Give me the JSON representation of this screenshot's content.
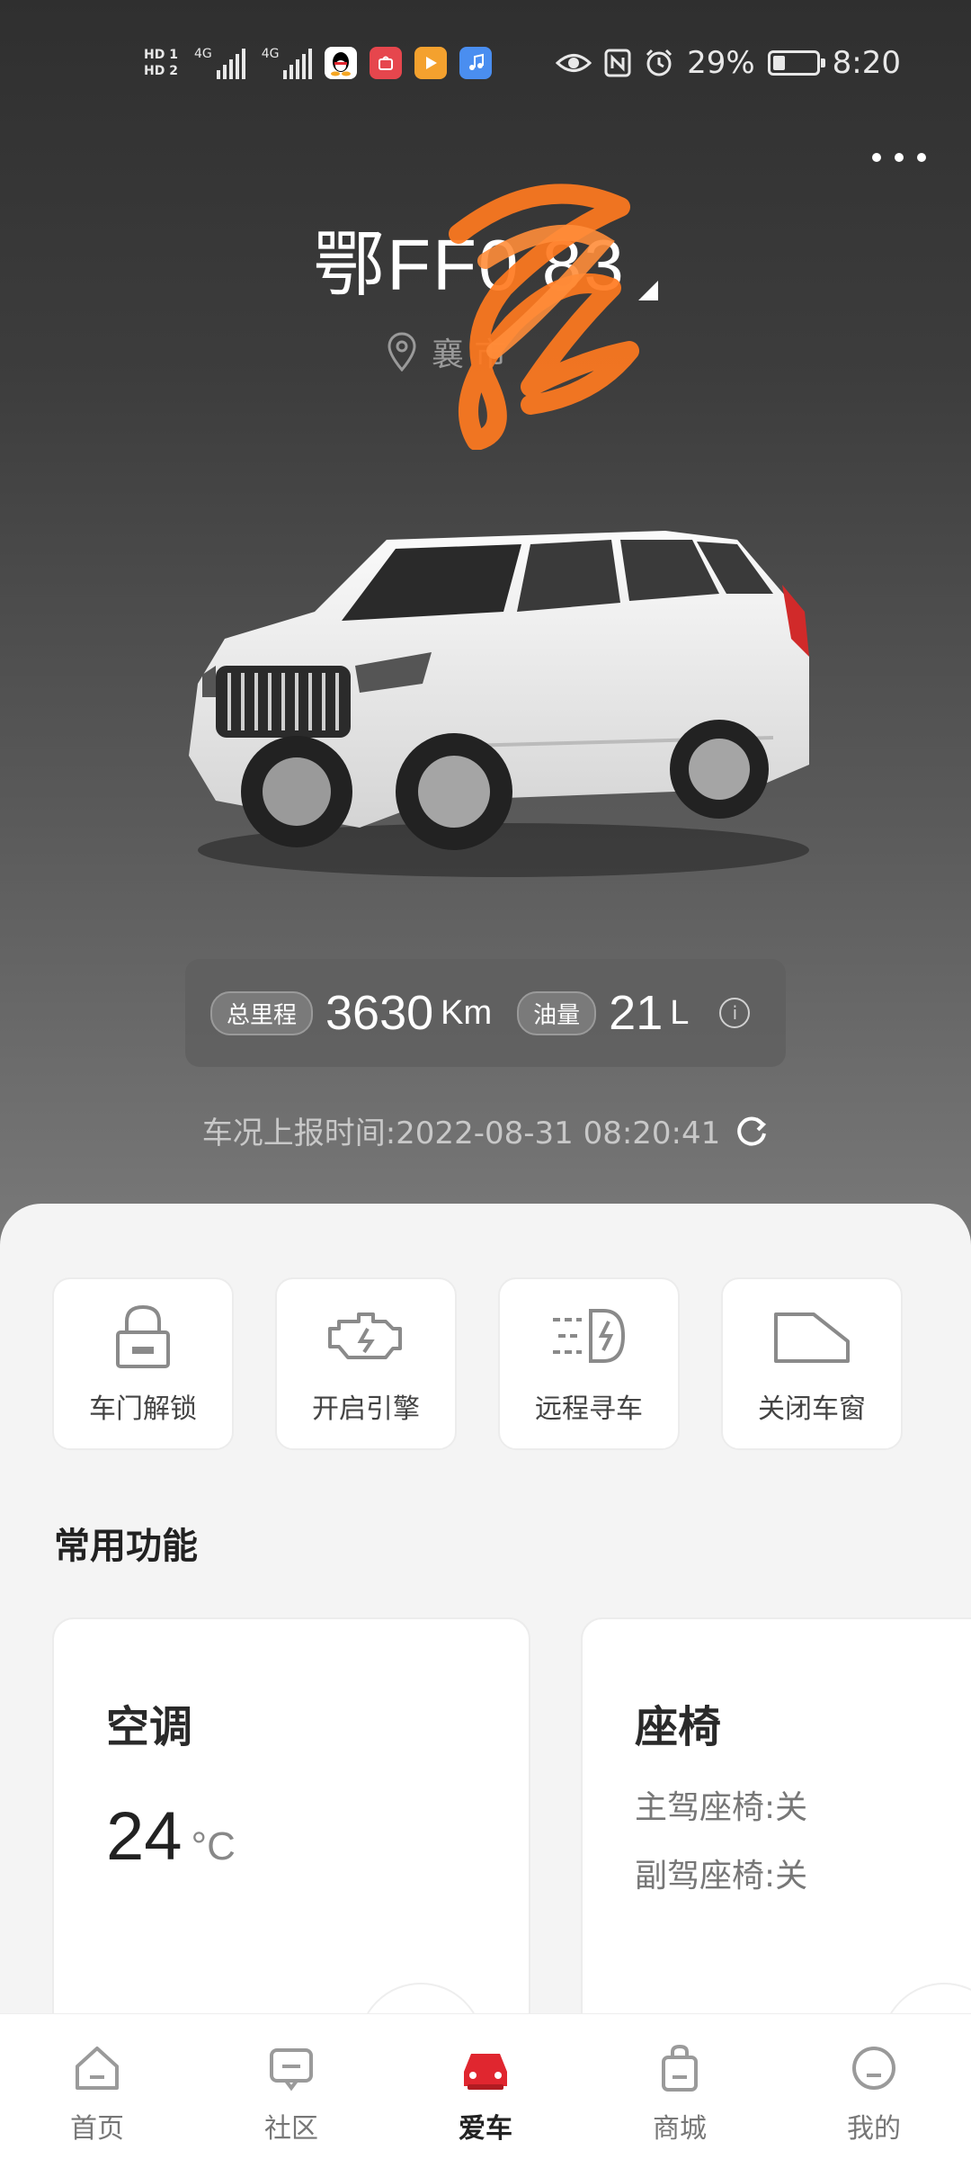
{
  "status_bar": {
    "hd1": "HD 1",
    "hd2": "HD 2",
    "net1": "4G",
    "net2": "4G",
    "battery_percent": "29%",
    "battery_level": 0.29,
    "time": "8:20",
    "icons": [
      "qq-icon",
      "huawei-store-icon",
      "video-app-icon",
      "music-app-icon",
      "eye-icon",
      "nfc-icon",
      "alarm-icon",
      "battery-icon"
    ]
  },
  "vehicle": {
    "plate": "鄂FF0 83",
    "location": "襄 市"
  },
  "stats": {
    "mileage_label": "总里程",
    "mileage_value": "3630",
    "mileage_unit": "Km",
    "fuel_label": "油量",
    "fuel_value": "21",
    "fuel_unit": "L"
  },
  "report_time": "车况上报时间:2022-08-31 08:20:41",
  "quick_actions": [
    {
      "label": "车门解锁",
      "icon": "lock-icon"
    },
    {
      "label": "开启引擎",
      "icon": "engine-icon"
    },
    {
      "label": "远程寻车",
      "icon": "headlight-icon"
    },
    {
      "label": "关闭车窗",
      "icon": "window-icon"
    }
  ],
  "section_title": "常用功能",
  "ac_card": {
    "title": "空调",
    "temp": "24",
    "unit": "°C"
  },
  "seat_card": {
    "title": "座椅",
    "driver": "主驾座椅:关",
    "passenger": "副驾座椅:关"
  },
  "bottom_nav": [
    {
      "label": "首页",
      "icon": "home-icon"
    },
    {
      "label": "社区",
      "icon": "community-icon"
    },
    {
      "label": "爱车",
      "icon": "car-icon"
    },
    {
      "label": "商城",
      "icon": "shop-icon"
    },
    {
      "label": "我的",
      "icon": "profile-icon"
    }
  ],
  "colors": {
    "accent": "#e0262f",
    "hero_top": "#2f2f2f",
    "hero_bottom": "#7a7a7a",
    "scribble": "#ff7a1f"
  }
}
